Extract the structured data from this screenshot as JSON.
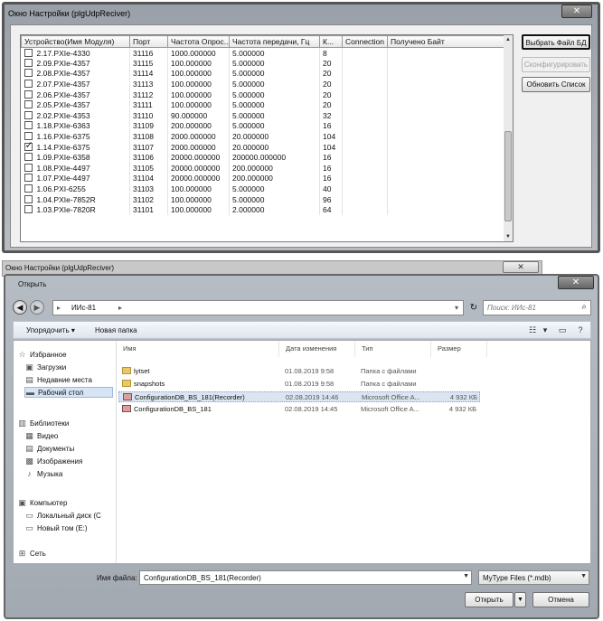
{
  "settings_window": {
    "title": "Окно Настройки (plgUdpReciver)",
    "close_glyph": "✕",
    "columns": [
      "Устройство(Имя Модуля)",
      "Порт",
      "Частота Опрос...",
      "Частота передачи, Гц",
      "К...",
      "Connection",
      "Получено Байт"
    ],
    "rows": [
      {
        "checked": false,
        "device": "2.17.PXIe-4330",
        "port": "31116",
        "poll": "1000.000000",
        "send": "5.000000",
        "k": "8"
      },
      {
        "checked": false,
        "device": "2.09.PXIe-4357",
        "port": "31115",
        "poll": "100.000000",
        "send": "5.000000",
        "k": "20"
      },
      {
        "checked": false,
        "device": "2.08.PXIe-4357",
        "port": "31114",
        "poll": "100.000000",
        "send": "5.000000",
        "k": "20"
      },
      {
        "checked": false,
        "device": "2.07.PXIe-4357",
        "port": "31113",
        "poll": "100.000000",
        "send": "5.000000",
        "k": "20"
      },
      {
        "checked": false,
        "device": "2.06.PXIe-4357",
        "port": "31112",
        "poll": "100.000000",
        "send": "5.000000",
        "k": "20"
      },
      {
        "checked": false,
        "device": "2.05.PXIe-4357",
        "port": "31111",
        "poll": "100.000000",
        "send": "5.000000",
        "k": "20"
      },
      {
        "checked": false,
        "device": "2.02.PXIe-4353",
        "port": "31110",
        "poll": "90.000000",
        "send": "5.000000",
        "k": "32"
      },
      {
        "checked": false,
        "device": "1.18.PXIe-6363",
        "port": "31109",
        "poll": "200.000000",
        "send": "5.000000",
        "k": "16"
      },
      {
        "checked": false,
        "device": "1.16.PXIe-6375",
        "port": "31108",
        "poll": "2000.000000",
        "send": "20.000000",
        "k": "104"
      },
      {
        "checked": true,
        "device": "1.14.PXIe-6375",
        "port": "31107",
        "poll": "2000.000000",
        "send": "20.000000",
        "k": "104"
      },
      {
        "checked": false,
        "device": "1.09.PXIe-6358",
        "port": "31106",
        "poll": "20000.000000",
        "send": "200000.000000",
        "k": "16"
      },
      {
        "checked": false,
        "device": "1.08.PXIe-4497",
        "port": "31105",
        "poll": "20000.000000",
        "send": "200.000000",
        "k": "16"
      },
      {
        "checked": false,
        "device": "1.07.PXIe-4497",
        "port": "31104",
        "poll": "20000.000000",
        "send": "200.000000",
        "k": "16"
      },
      {
        "checked": false,
        "device": "1.06.PXI-6255",
        "port": "31103",
        "poll": "100.000000",
        "send": "5.000000",
        "k": "40"
      },
      {
        "checked": false,
        "device": "1.04.PXIe-7852R",
        "port": "31102",
        "poll": "100.000000",
        "send": "5.000000",
        "k": "96"
      },
      {
        "checked": false,
        "device": "1.03.PXIe-7820R",
        "port": "31101",
        "poll": "100.000000",
        "send": "2.000000",
        "k": "64"
      }
    ],
    "buttons": {
      "select_db": "Выбрать Файл БД",
      "configure": "Сконфигурировать",
      "refresh_list": "Обновить Список"
    }
  },
  "background_window": {
    "title": "Окно Настройки (plgUdpReciver)",
    "close_glyph": "✕"
  },
  "open_dialog": {
    "title": "Открыть",
    "close_glyph": "✕",
    "path": [
      "ИИс-81"
    ],
    "search_placeholder": "Поиск: ИИс-81",
    "toolbar": {
      "organize": "Упорядочить ▾",
      "new_folder": "Новая папка"
    },
    "nav": {
      "favorites": "Избранное",
      "downloads": "Загрузки",
      "recent": "Недавние места",
      "desktop": "Рабочий стол",
      "libraries": "Библиотеки",
      "video": "Видео",
      "documents": "Документы",
      "images": "Изображения",
      "music": "Музыка",
      "computer": "Компьютер",
      "local_disk": "Локальный диск (C",
      "new_volume": "Новый том (E:)",
      "network": "Сеть"
    },
    "file_columns": {
      "name": "Имя",
      "date": "Дата изменения",
      "type": "Тип",
      "size": "Размер"
    },
    "files": [
      {
        "name": "lytset",
        "date": "01.08.2019 9:58",
        "type": "Папка с файлами",
        "size": ""
      },
      {
        "name": "snapshots",
        "date": "01.08.2019 9:58",
        "type": "Папка с файлами",
        "size": ""
      },
      {
        "name": "ConfigurationDB_BS_181(Recorder)",
        "date": "02.08.2019 14:46",
        "type": "Microsoft Office A...",
        "size": "4 932 КБ"
      },
      {
        "name": "ConfigurationDB_BS_181",
        "date": "02.08.2019 14:45",
        "type": "Microsoft Office A...",
        "size": "4 932 КБ"
      }
    ],
    "filename_label": "Имя файла:",
    "filename_value": "ConfigurationDB_BS_181(Recorder)",
    "filetype_value": "MyType Files (*.mdb)",
    "open_button": "Открыть",
    "cancel_button": "Отмена"
  }
}
